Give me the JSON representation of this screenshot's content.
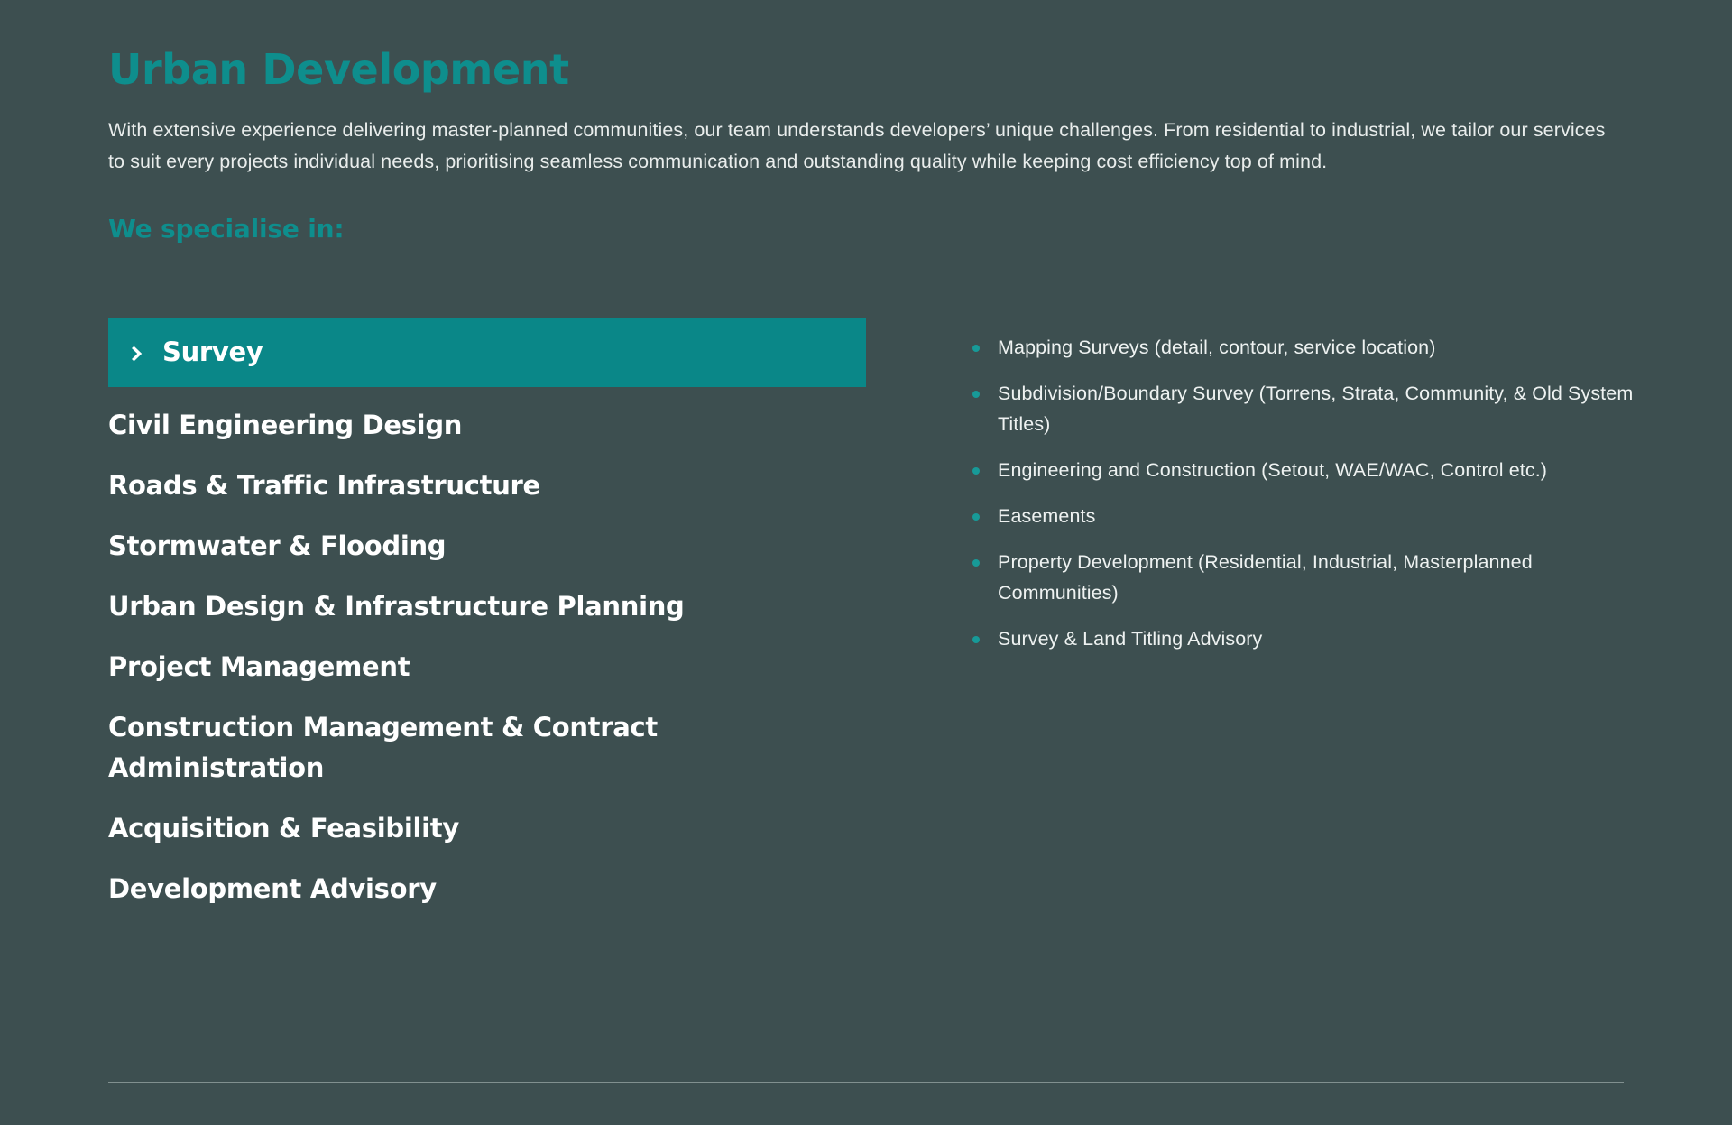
{
  "section": {
    "title": "Urban Development",
    "intro": "With extensive experience delivering master-planned communities, our team understands developers’ unique challenges. From residential to industrial, we tailor our services to suit every projects individual needs, prioritising seamless communication and outstanding quality while keeping cost efficiency top of mind.",
    "specialise_heading": "We specialise in:"
  },
  "colors": {
    "background": "#3d4f50",
    "accent_teal": "#0e8e8d",
    "active_tab_bg": "#0a8788",
    "text": "#eef2f1",
    "divider": "#8d9b9a",
    "bullet": "#179a98"
  },
  "accordion": {
    "active_index": 0,
    "chevron_icon": "chevron-right-icon",
    "items": [
      {
        "label": "Survey"
      },
      {
        "label": "Civil Engineering Design"
      },
      {
        "label": "Roads & Traffic Infrastructure"
      },
      {
        "label": "Stormwater & Flooding"
      },
      {
        "label": "Urban Design & Infrastructure Planning"
      },
      {
        "label": "Project Management"
      },
      {
        "label": "Construction Management & Contract Administration"
      },
      {
        "label": "Acquisition & Feasibility"
      },
      {
        "label": "Development Advisory"
      }
    ]
  },
  "details": {
    "bullets": [
      {
        "text": "Mapping Surveys (detail, contour, service location)"
      },
      {
        "text": "Subdivision/Boundary Survey (Torrens, Strata, Community, & Old System Titles)"
      },
      {
        "text": "Engineering and Construction (Setout, WAE/WAC, Control etc.)"
      },
      {
        "text": "Easements"
      },
      {
        "text": "Property Development (Residential, Industrial, Masterplanned Communities)"
      },
      {
        "text": "Survey & Land Titling Advisory"
      }
    ]
  }
}
